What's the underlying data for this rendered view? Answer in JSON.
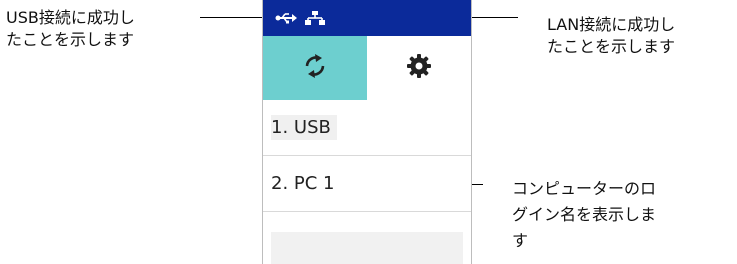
{
  "annotations": {
    "usb_success": "USB接続に成功し\nたことを示します",
    "lan_success": "LAN接続に成功し\nたことを示します",
    "pc_login_name": "コンピューターのロ\nグイン名を表示しま\nす"
  },
  "status_bar": {
    "icons": [
      "usb-icon",
      "lan-icon"
    ],
    "background": "#0b2a9a"
  },
  "tabs": [
    {
      "icon": "sync-icon",
      "active": true,
      "color": "#6dcfcf"
    },
    {
      "icon": "gear-icon",
      "active": false
    }
  ],
  "list": {
    "items": [
      {
        "label": "1. USB"
      },
      {
        "label": "2. PC 1"
      }
    ]
  }
}
